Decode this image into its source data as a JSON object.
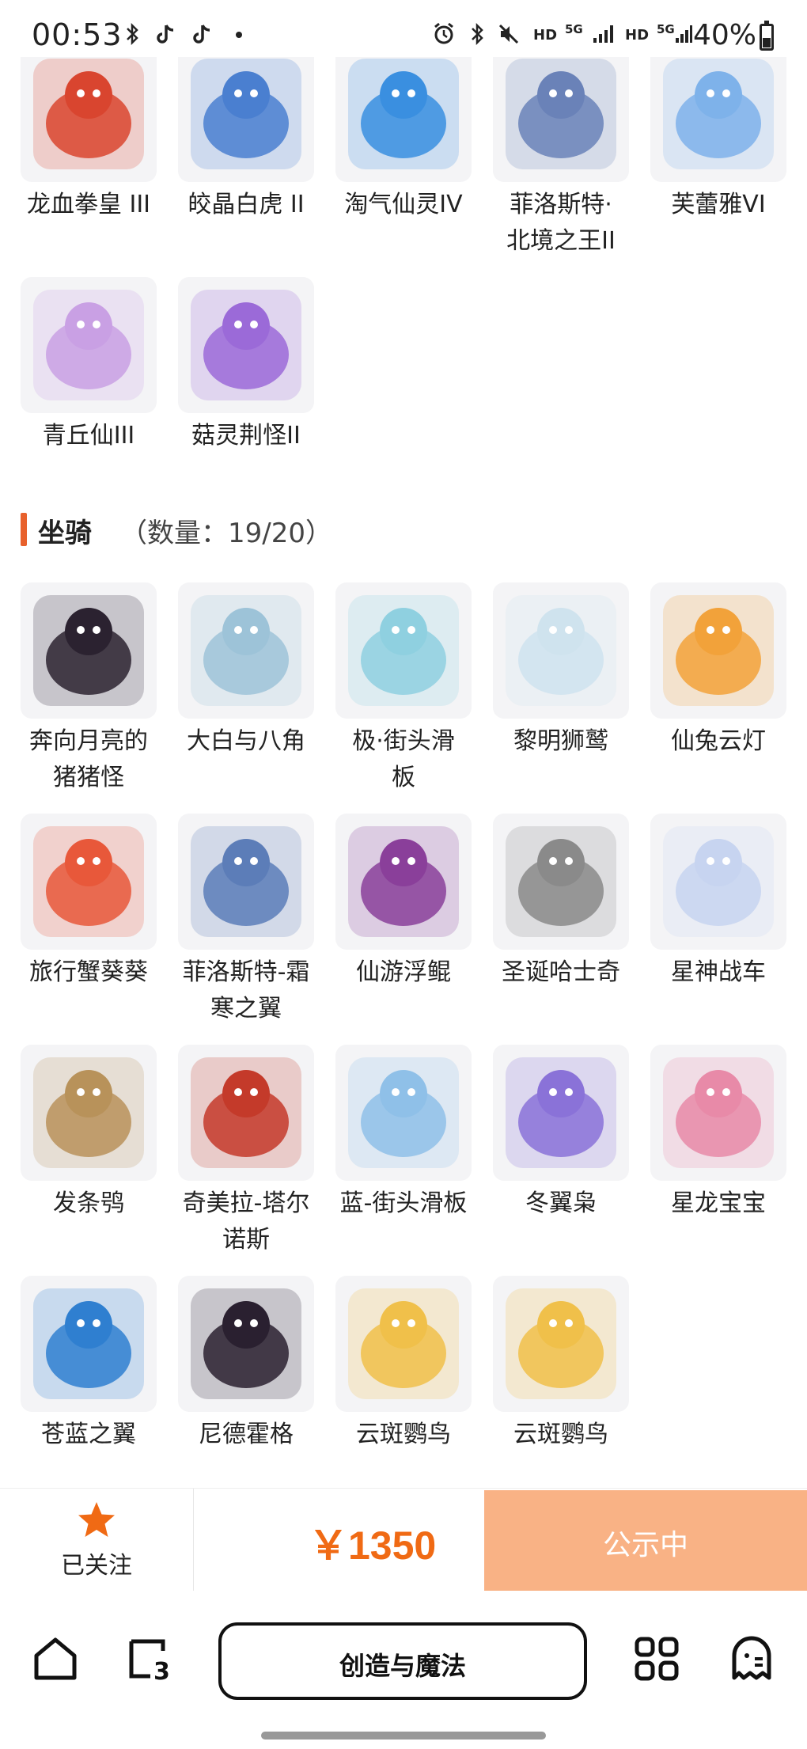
{
  "status_bar": {
    "time": "00:53",
    "network_hd_1": "HD",
    "network_5g_1": "5G",
    "network_hd_2": "HD",
    "network_5g_2": "5G",
    "battery": "40%"
  },
  "pets": {
    "items": [
      {
        "label_lines": [
          "龙血拳皇 III"
        ],
        "icon": "red-dragon-boxer-pet",
        "color": "#d9452f"
      },
      {
        "label_lines": [
          "皎晶白虎 II"
        ],
        "icon": "white-tiger-pet",
        "color": "#4a7fd0"
      },
      {
        "label_lines": [
          "淘气仙灵IV"
        ],
        "icon": "blue-puppy-pet",
        "color": "#3a8fe0"
      },
      {
        "label_lines": [
          "菲洛斯特·",
          "北境之王II"
        ],
        "icon": "frost-king-pet",
        "color": "#6a82b8"
      },
      {
        "label_lines": [
          "芙蕾雅VI"
        ],
        "icon": "freya-pet",
        "color": "#7eb2ea"
      },
      {
        "label_lines": [
          "青丘仙III"
        ],
        "icon": "fox-fairy-pet",
        "color": "#c9a0e4"
      },
      {
        "label_lines": [
          "菇灵荆怪II"
        ],
        "icon": "mushroom-sprite-pet",
        "color": "#9b6ad8"
      }
    ]
  },
  "mounts_section": {
    "title": "坐骑",
    "count": "（数量：19/20）",
    "accent": "#e8612c"
  },
  "mounts": {
    "items": [
      {
        "label_lines": [
          "奔向月亮的",
          "猪猪怪"
        ],
        "icon": "moon-pig-mount",
        "color": "#2b2230"
      },
      {
        "label_lines": [
          "大白与八角"
        ],
        "icon": "white-whale-mount",
        "color": "#9dc3d8"
      },
      {
        "label_lines": [
          "极·街头滑",
          "板"
        ],
        "icon": "street-skateboard-mount",
        "color": "#8fd0e0"
      },
      {
        "label_lines": [
          "黎明狮鹫"
        ],
        "icon": "dawn-griffin-mount",
        "color": "#cfe3ee"
      },
      {
        "label_lines": [
          "仙兔云灯"
        ],
        "icon": "rabbit-lantern-mount",
        "color": "#f2a23a"
      },
      {
        "label_lines": [
          "旅行蟹葵葵"
        ],
        "icon": "travel-crab-mount",
        "color": "#e8583a"
      },
      {
        "label_lines": [
          "菲洛斯特-霜",
          "寒之翼"
        ],
        "icon": "frost-wing-mount",
        "color": "#5c7db8"
      },
      {
        "label_lines": [
          "仙游浮鲲"
        ],
        "icon": "floating-kun-mount",
        "color": "#8a3f9a"
      },
      {
        "label_lines": [
          "圣诞哈士奇"
        ],
        "icon": "christmas-husky-mount",
        "color": "#8a8a8a"
      },
      {
        "label_lines": [
          "星神战车"
        ],
        "icon": "star-chariot-mount",
        "color": "#c7d4f0"
      },
      {
        "label_lines": [
          "发条鸮"
        ],
        "icon": "clockwork-owl-mount",
        "color": "#b8925a"
      },
      {
        "label_lines": [
          "奇美拉-塔尔",
          "诺斯"
        ],
        "icon": "chimera-mount",
        "color": "#c43a2a"
      },
      {
        "label_lines": [
          "蓝-街头滑板"
        ],
        "icon": "blue-skateboard-mount",
        "color": "#8fc0e8"
      },
      {
        "label_lines": [
          "冬翼枭"
        ],
        "icon": "winter-owl-mount",
        "color": "#8a72d8"
      },
      {
        "label_lines": [
          "星龙宝宝"
        ],
        "icon": "star-dragon-baby-mount",
        "color": "#e88aa8"
      },
      {
        "label_lines": [
          "苍蓝之翼"
        ],
        "icon": "azure-wing-mount",
        "color": "#2f7fd0"
      },
      {
        "label_lines": [
          "尼德霍格"
        ],
        "icon": "nidhogg-mount",
        "color": "#2a2030"
      },
      {
        "label_lines": [
          "云斑鹦鸟"
        ],
        "icon": "cloud-parrot-mount",
        "color": "#f0c04a"
      },
      {
        "label_lines": [
          "云斑鹦鸟"
        ],
        "icon": "cloud-parrot-mount",
        "color": "#f0c04a"
      }
    ]
  },
  "buy_bar": {
    "follow_label": "已关注",
    "follow_icon": "star-icon",
    "star_color": "#f06a14",
    "price": "￥1350",
    "price_color": "#f06a14",
    "status_label": "公示中",
    "status_color": "#f9b285"
  },
  "nav_bar": {
    "center_label": "创造与魔法",
    "left_icons": [
      "home-icon",
      "tab-count-icon"
    ],
    "tab_count": "3",
    "right_icons": [
      "apps-grid-icon",
      "ghost-menu-icon"
    ]
  }
}
